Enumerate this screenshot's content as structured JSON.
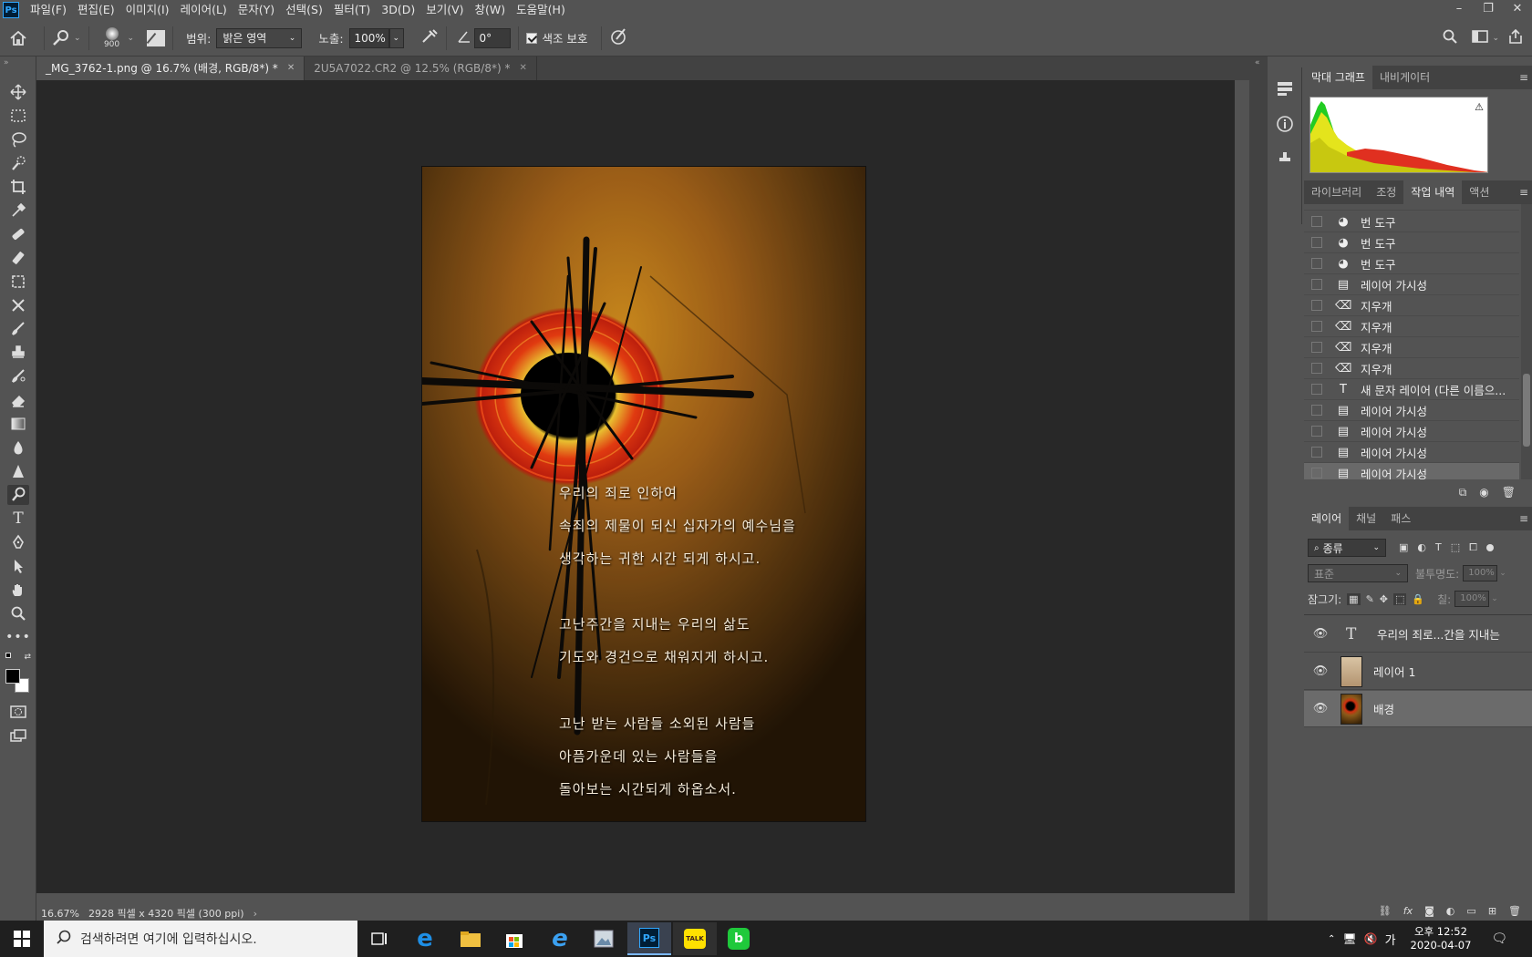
{
  "app": {
    "logo": "Ps"
  },
  "menu": [
    "파일(F)",
    "편집(E)",
    "이미지(I)",
    "레이어(L)",
    "문자(Y)",
    "선택(S)",
    "필터(T)",
    "3D(D)",
    "보기(V)",
    "창(W)",
    "도움말(H)"
  ],
  "options": {
    "brush_size": "900",
    "range_label": "범위:",
    "range_value": "밝은 영역",
    "exposure_label": "노출:",
    "exposure_value": "100%",
    "angle_value": "0°",
    "protect_tones_label": "색조 보호",
    "protect_tones_checked": true
  },
  "tabs": [
    {
      "label": "_MG_3762-1.png @ 16.7% (배경, RGB/8*) *",
      "active": true
    },
    {
      "label": "2U5A7022.CR2 @ 12.5% (RGB/8*) *",
      "active": false
    }
  ],
  "artwork": {
    "lines": [
      "우리의 죄로 인하여",
      "속죄의 제물이 되신 십자가의 예수님을",
      "생각하는 귀한 시간 되게 하시고.",
      "고난주간을 지내는 우리의 삶도",
      "기도와 경건으로 채워지게 하시고.",
      "고난 받는 사람들 소외된 사람들",
      "아픔가운데 있는 사람들을",
      "돌아보는 시간되게 하옵소서."
    ]
  },
  "status": {
    "zoom": "16.67%",
    "doc_info": "2928 픽셀 x 4320 픽셀 (300 ppi)"
  },
  "histogram_panel": {
    "tabs": [
      "막대 그래프",
      "내비게이터"
    ],
    "warning_icon": "warning-icon"
  },
  "history_panel": {
    "tabs": [
      "라이브러리",
      "조정",
      "작업 내역",
      "액션"
    ],
    "active_tab": "작업 내역",
    "items": [
      {
        "icon": "burn-tool-icon",
        "label": "번 도구"
      },
      {
        "icon": "burn-tool-icon",
        "label": "번 도구"
      },
      {
        "icon": "burn-tool-icon",
        "label": "번 도구"
      },
      {
        "icon": "document-icon",
        "label": "레이어 가시성"
      },
      {
        "icon": "eraser-icon",
        "label": "지우개"
      },
      {
        "icon": "eraser-icon",
        "label": "지우개"
      },
      {
        "icon": "eraser-icon",
        "label": "지우개"
      },
      {
        "icon": "eraser-icon",
        "label": "지우개"
      },
      {
        "icon": "type-icon",
        "label": "새 문자 레이어 (다른 이름으..."
      },
      {
        "icon": "document-icon",
        "label": "레이어 가시성"
      },
      {
        "icon": "document-icon",
        "label": "레이어 가시성"
      },
      {
        "icon": "document-icon",
        "label": "레이어 가시성"
      },
      {
        "icon": "document-icon",
        "label": "레이어 가시성"
      }
    ]
  },
  "layers_panel": {
    "tabs": [
      "레이어",
      "채널",
      "패스"
    ],
    "filter_label": "종류",
    "blend_mode": "표준",
    "opacity_label": "불투명도:",
    "opacity_value": "100%",
    "lock_label": "잠그기:",
    "fill_label": "칠:",
    "fill_value": "100%",
    "layers": [
      {
        "name": "우리의 죄로...간을 지내는",
        "kind": "text"
      },
      {
        "name": "레이어 1",
        "kind": "image"
      },
      {
        "name": "배경",
        "kind": "background",
        "locked": true
      }
    ]
  },
  "taskbar": {
    "search_placeholder": "검색하려면 여기에 입력하십시오.",
    "time": "오후 12:52",
    "date": "2020-04-07",
    "ime": "가"
  },
  "colors": {
    "accent": "#31a8ff",
    "panel": "#535353",
    "canvas_bg": "#282828"
  }
}
